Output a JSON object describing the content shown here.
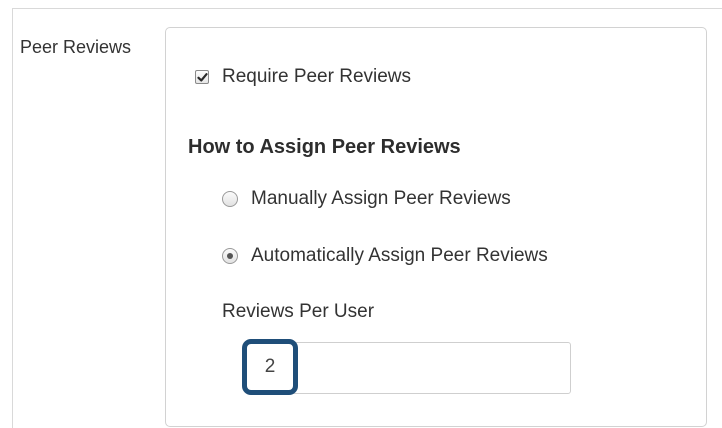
{
  "section": {
    "label": "Peer Reviews"
  },
  "require_peer_reviews": {
    "label": "Require Peer Reviews",
    "checked": true
  },
  "assignment": {
    "heading": "How to Assign Peer Reviews",
    "options": [
      {
        "label": "Manually Assign Peer Reviews",
        "selected": false
      },
      {
        "label": "Automatically Assign Peer Reviews",
        "selected": true
      }
    ]
  },
  "reviews_per_user": {
    "label": "Reviews Per User",
    "value": "2"
  },
  "colors": {
    "highlight_border": "#1f4e79",
    "panel_border": "#d2d2d2",
    "text": "#333333"
  },
  "icons": {
    "checkbox_check": "check-icon"
  }
}
